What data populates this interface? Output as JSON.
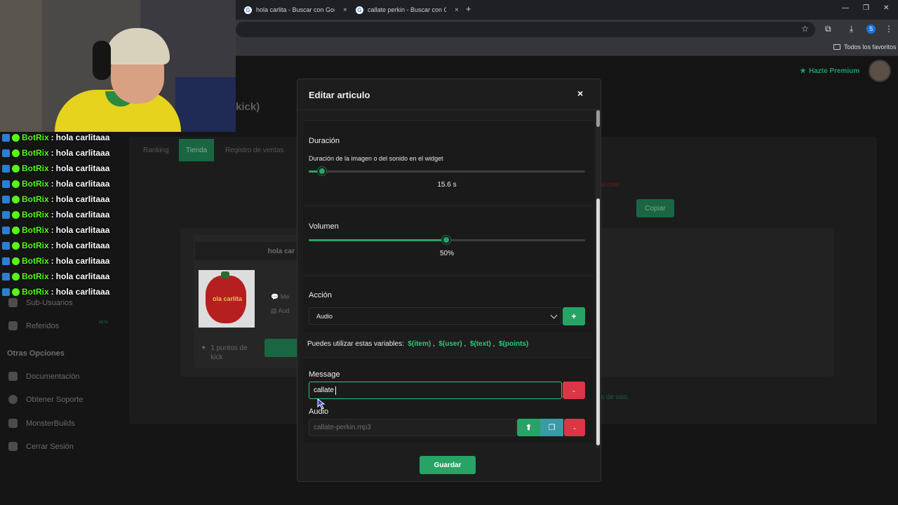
{
  "browser": {
    "tabs": [
      {
        "title": "hola carlita - Buscar con Google"
      },
      {
        "title": "callate perkin - Buscar con Google"
      }
    ],
    "favicon_letter": "G",
    "profile_letter": "S",
    "bookmark_folder": "Todos los favoritos"
  },
  "header": {
    "premium_label": "Hazte Premium",
    "page_title_fragment": "kick)"
  },
  "sidebar": {
    "items": [
      {
        "label": "Sub-Usuarios",
        "icon": "users-icon"
      },
      {
        "label": "Referidos",
        "icon": "referrals-icon",
        "badge": "BETA"
      }
    ],
    "section_heading": "Otras Opciones",
    "other_options": [
      {
        "label": "Documentación",
        "icon": "docs-icon"
      },
      {
        "label": "Obtener Soporte",
        "icon": "support-icon"
      },
      {
        "label": "MonsterBuilds",
        "icon": "monitor-icon"
      },
      {
        "label": "Cerrar Sesión",
        "icon": "logout-icon"
      }
    ]
  },
  "store": {
    "tabs": [
      "Ranking",
      "Tienda",
      "Registro de ventas"
    ],
    "active_tab": "Tienda",
    "copy_label": "Copiar",
    "card": {
      "title": "hola car",
      "image_text": "ola carlita",
      "points_label": "1 puntos de kick",
      "meta_1": "Me",
      "meta_2": "Aud"
    }
  },
  "chat": {
    "username": "BotRix",
    "separator": ":",
    "messages": [
      "hola carlitaaa",
      "hola carlitaaa",
      "hola carlitaaa",
      "hola carlitaaa",
      "hola carlitaaa",
      "hola carlitaaa",
      "hola carlitaaa",
      "hola carlitaaa",
      "hola carlitaaa",
      "hola carlitaaa",
      "hola carlitaaa"
    ]
  },
  "modal": {
    "title": "Editar articulo",
    "close_label": "×",
    "duration": {
      "label": "Duración",
      "sublabel": "Duración de la imagen o del sonido en el widget",
      "value_text": "15.6 s",
      "fraction": 0.05
    },
    "volume": {
      "label": "Volumen",
      "value_text": "50%",
      "fraction": 0.5
    },
    "action": {
      "label": "Acción",
      "selected": "Audio",
      "add_label": "+"
    },
    "variables": {
      "intro": "Puedes utilizar estas variables:",
      "items": [
        "$(item)",
        "$(user)",
        "$(text)",
        "$(points)"
      ],
      "separator": ","
    },
    "message": {
      "label": "Message",
      "value": "callate",
      "remove_label": "-"
    },
    "audio": {
      "label": "Audio",
      "value": "callate-perkin.mp3",
      "remove_label": "-"
    },
    "save_label": "Guardar"
  },
  "colors": {
    "accent": "#28a366",
    "danger": "#dc3545",
    "variable": "#2bc97b",
    "kick_green": "#53fc18"
  }
}
